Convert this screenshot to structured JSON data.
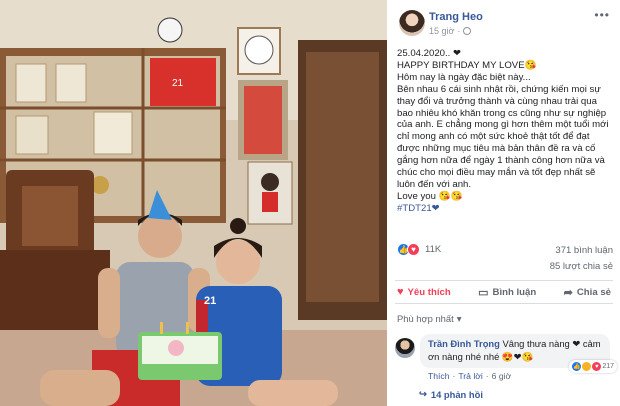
{
  "post": {
    "author": "Trang Heo",
    "time": "15 giờ",
    "body_lines": [
      "25.04.2020.. ❤",
      "HAPPY BIRTHDAY MY LOVE😘",
      "Hôm nay là ngày đặc biệt này...",
      "Bên nhau 6 cái sinh nhật rồi, chứng kiến mọi sự thay đổi và trưởng thành và cùng nhau trải qua bao nhiêu khó khăn trong cs cũng như sự nghiệp của anh. E chẳng mong gì hơn thêm một tuổi mới chỉ mong anh có một sức khoẻ thật tốt để đạt được những mục tiêu mà bản thân đề ra và cố gắng hơn nữa để ngày 1 thành công hơn nữa và chúc cho mọi điều may mắn và tốt đẹp nhất sẽ luôn đến với anh.",
      "Love you 😘😘",
      "#TDT21❤"
    ],
    "reactions_count": "11K",
    "comments_count": "371 bình luận",
    "shares_count": "85 lượt chia sẻ"
  },
  "actions": {
    "like": "Yêu thích",
    "comment": "Bình luận",
    "share": "Chia sẻ"
  },
  "comments_sort": "Phù hợp nhất",
  "comment": {
    "author": "Trần Đình Trọng",
    "text": "Vâng thưa nàng ❤ cảm ơn nàng nhé nhé 😍❤😘",
    "like_label": "Thích",
    "reply_label": "Trả lời",
    "time": "6 giờ",
    "reaction_count": "217"
  },
  "replies_label": "14 phản hồi",
  "colors": {
    "link_blue": "#385898",
    "love_red": "#f33e58",
    "muted": "#606770"
  }
}
